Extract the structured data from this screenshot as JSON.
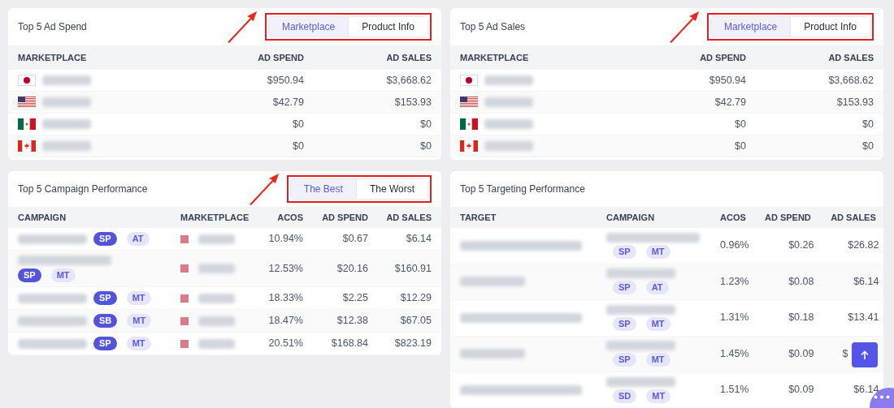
{
  "ad_spend": {
    "title": "Top 5 Ad Spend",
    "toggle": [
      {
        "label": "Marketplace",
        "selected": true
      },
      {
        "label": "Product Info",
        "selected": false
      }
    ],
    "columns": [
      "MARKETPLACE",
      "AD SPEND",
      "AD SALES"
    ],
    "rows": [
      {
        "kind": "jp",
        "ad_spend": "$950.94",
        "ad_sales": "$3,668.62"
      },
      {
        "kind": "us",
        "ad_spend": "$42.79",
        "ad_sales": "$153.93"
      },
      {
        "kind": "mx",
        "ad_spend": "$0",
        "ad_sales": "$0"
      },
      {
        "kind": "ca",
        "ad_spend": "$0",
        "ad_sales": "$0"
      }
    ]
  },
  "ad_sales": {
    "title": "Top 5 Ad Sales",
    "toggle": [
      {
        "label": "Marketplace",
        "selected": true
      },
      {
        "label": "Product Info",
        "selected": false
      }
    ],
    "columns": [
      "MARKETPLACE",
      "AD SPEND",
      "AD SALES"
    ],
    "rows": [
      {
        "kind": "jp",
        "ad_spend": "$950.94",
        "ad_sales": "$3,668.62"
      },
      {
        "kind": "us",
        "ad_spend": "$42.79",
        "ad_sales": "$153.93"
      },
      {
        "kind": "mx",
        "ad_spend": "$0",
        "ad_sales": "$0"
      },
      {
        "kind": "ca",
        "ad_spend": "$0",
        "ad_sales": "$0"
      }
    ]
  },
  "campaign_performance": {
    "title": "Top 5 Campaign Performance",
    "toggle": [
      {
        "label": "The Best",
        "selected": true
      },
      {
        "label": "The Worst",
        "selected": false
      }
    ],
    "columns": [
      "CAMPAIGN",
      "MARKETPLACE",
      "ACOS",
      "AD SPEND",
      "AD SALES"
    ],
    "rows": [
      {
        "tags": [
          {
            "label": "SP",
            "solid": true
          },
          {
            "label": "AT",
            "solid": false
          }
        ],
        "wrap": false,
        "acos": "10.94%",
        "ad_spend": "$0.67",
        "ad_sales": "$6.14"
      },
      {
        "tags": [
          {
            "label": "SP",
            "solid": true
          },
          {
            "label": "MT",
            "solid": false
          }
        ],
        "wrap": true,
        "acos": "12.53%",
        "ad_spend": "$20.16",
        "ad_sales": "$160.91"
      },
      {
        "tags": [
          {
            "label": "SP",
            "solid": true
          },
          {
            "label": "MT",
            "solid": false
          }
        ],
        "wrap": false,
        "acos": "18.33%",
        "ad_spend": "$2.25",
        "ad_sales": "$12.29"
      },
      {
        "tags": [
          {
            "label": "SB",
            "solid": true
          },
          {
            "label": "MT",
            "solid": false
          }
        ],
        "wrap": false,
        "acos": "18.47%",
        "ad_spend": "$12.38",
        "ad_sales": "$67.05"
      },
      {
        "tags": [
          {
            "label": "SP",
            "solid": true
          },
          {
            "label": "MT",
            "solid": false
          }
        ],
        "wrap": false,
        "acos": "20.51%",
        "ad_spend": "$168.84",
        "ad_sales": "$823.19"
      }
    ]
  },
  "targeting_performance": {
    "title": "Top 5 Targeting Performance",
    "columns": [
      "TARGET",
      "CAMPAIGN",
      "ACOS",
      "AD SPEND",
      "AD SALES"
    ],
    "rows": [
      {
        "tags": [
          {
            "label": "SP",
            "solid": false
          },
          {
            "label": "MT",
            "solid": false
          }
        ],
        "acos": "0.96%",
        "ad_spend": "$0.26",
        "ad_sales": "$26.82"
      },
      {
        "tags": [
          {
            "label": "SP",
            "solid": false
          },
          {
            "label": "AT",
            "solid": false
          }
        ],
        "acos": "1.23%",
        "ad_spend": "$0.08",
        "ad_sales": "$6.14"
      },
      {
        "tags": [
          {
            "label": "SP",
            "solid": false
          },
          {
            "label": "MT",
            "solid": false
          }
        ],
        "acos": "1.31%",
        "ad_spend": "$0.18",
        "ad_sales": "$13.41"
      },
      {
        "tags": [
          {
            "label": "SP",
            "solid": false
          },
          {
            "label": "MT",
            "solid": false
          }
        ],
        "acos": "1.45%",
        "ad_spend": "$0.09",
        "ad_sales": "$"
      },
      {
        "tags": [
          {
            "label": "SD",
            "solid": false
          },
          {
            "label": "MT",
            "solid": false
          }
        ],
        "acos": "1.51%",
        "ad_spend": "$0.09",
        "ad_sales": "$6.14"
      }
    ]
  }
}
